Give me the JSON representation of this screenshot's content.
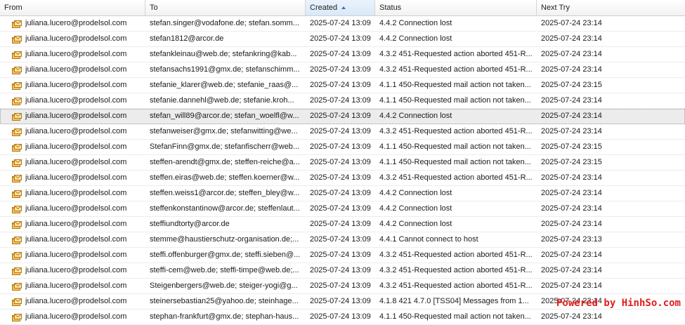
{
  "columns": {
    "from": "From",
    "to": "To",
    "created": "Created",
    "status": "Status",
    "next_try": "Next Try"
  },
  "sort": {
    "column": "created",
    "direction": "ascending"
  },
  "selected_row": 6,
  "icons": {
    "row_icon": "mail-envelope-icon",
    "accent": "#f0a830"
  },
  "rows": [
    {
      "from": "juliana.lucero@prodelsol.com",
      "to": "stefan.singer@vodafone.de; stefan.somm...",
      "created": "2025-07-24 13:09",
      "status": "4.4.2 Connection lost",
      "next_try": "2025-07-24 23:14"
    },
    {
      "from": "juliana.lucero@prodelsol.com",
      "to": "stefan1812@arcor.de",
      "created": "2025-07-24 13:09",
      "status": "4.4.2 Connection lost",
      "next_try": "2025-07-24 23:14"
    },
    {
      "from": "juliana.lucero@prodelsol.com",
      "to": "stefankleinau@web.de; stefankring@kab...",
      "created": "2025-07-24 13:09",
      "status": "4.3.2 451-Requested action aborted 451-R...",
      "next_try": "2025-07-24 23:14"
    },
    {
      "from": "juliana.lucero@prodelsol.com",
      "to": "stefansachs1991@gmx.de; stefanschimm...",
      "created": "2025-07-24 13:09",
      "status": "4.3.2 451-Requested action aborted 451-R...",
      "next_try": "2025-07-24 23:14"
    },
    {
      "from": "juliana.lucero@prodelsol.com",
      "to": "stefanie_klarer@web.de; stefanie_raas@...",
      "created": "2025-07-24 13:09",
      "status": "4.1.1 450-Requested mail action not taken...",
      "next_try": "2025-07-24 23:15"
    },
    {
      "from": "juliana.lucero@prodelsol.com",
      "to": "stefanie.dannehl@web.de; stefanie.kroh...",
      "created": "2025-07-24 13:09",
      "status": "4.1.1 450-Requested mail action not taken...",
      "next_try": "2025-07-24 23:14"
    },
    {
      "from": "juliana.lucero@prodelsol.com",
      "to": "stefan_will89@arcor.de; stefan_woelfl@w...",
      "created": "2025-07-24 13:09",
      "status": "4.4.2 Connection lost",
      "next_try": "2025-07-24 23:14"
    },
    {
      "from": "juliana.lucero@prodelsol.com",
      "to": "stefanweiser@gmx.de; stefanwitting@we...",
      "created": "2025-07-24 13:09",
      "status": "4.3.2 451-Requested action aborted 451-R...",
      "next_try": "2025-07-24 23:14"
    },
    {
      "from": "juliana.lucero@prodelsol.com",
      "to": "StefanFinn@gmx.de; stefanfischerr@web...",
      "created": "2025-07-24 13:09",
      "status": "4.1.1 450-Requested mail action not taken...",
      "next_try": "2025-07-24 23:15"
    },
    {
      "from": "juliana.lucero@prodelsol.com",
      "to": "steffen-arendt@gmx.de; steffen-reiche@a...",
      "created": "2025-07-24 13:09",
      "status": "4.1.1 450-Requested mail action not taken...",
      "next_try": "2025-07-24 23:15"
    },
    {
      "from": "juliana.lucero@prodelsol.com",
      "to": "steffen.eiras@web.de; steffen.koerner@w...",
      "created": "2025-07-24 13:09",
      "status": "4.3.2 451-Requested action aborted 451-R...",
      "next_try": "2025-07-24 23:14"
    },
    {
      "from": "juliana.lucero@prodelsol.com",
      "to": "steffen.weiss1@arcor.de; steffen_bley@w...",
      "created": "2025-07-24 13:09",
      "status": "4.4.2 Connection lost",
      "next_try": "2025-07-24 23:14"
    },
    {
      "from": "juliana.lucero@prodelsol.com",
      "to": "steffenkonstantinow@arcor.de; steffenlaut...",
      "created": "2025-07-24 13:09",
      "status": "4.4.2 Connection lost",
      "next_try": "2025-07-24 23:14"
    },
    {
      "from": "juliana.lucero@prodelsol.com",
      "to": "steffiundtorty@arcor.de",
      "created": "2025-07-24 13:09",
      "status": "4.4.2 Connection lost",
      "next_try": "2025-07-24 23:14"
    },
    {
      "from": "juliana.lucero@prodelsol.com",
      "to": "stemme@haustierschutz-organisation.de;...",
      "created": "2025-07-24 13:09",
      "status": "4.4.1 Cannot connect to host",
      "next_try": "2025-07-24 23:13"
    },
    {
      "from": "juliana.lucero@prodelsol.com",
      "to": "steffi.offenburger@gmx.de; steffi.sieben@...",
      "created": "2025-07-24 13:09",
      "status": "4.3.2 451-Requested action aborted 451-R...",
      "next_try": "2025-07-24 23:14"
    },
    {
      "from": "juliana.lucero@prodelsol.com",
      "to": "steffi-cem@web.de; steffi-timpe@web.de;...",
      "created": "2025-07-24 13:09",
      "status": "4.3.2 451-Requested action aborted 451-R...",
      "next_try": "2025-07-24 23:14"
    },
    {
      "from": "juliana.lucero@prodelsol.com",
      "to": "Steigenbergers@web.de; steiger-yogi@g...",
      "created": "2025-07-24 13:09",
      "status": "4.3.2 451-Requested action aborted 451-R...",
      "next_try": "2025-07-24 23:14"
    },
    {
      "from": "juliana.lucero@prodelsol.com",
      "to": "steinersebastian25@yahoo.de; steinhage...",
      "created": "2025-07-24 13:09",
      "status": "4.1.8 421 4.7.0 [TSS04] Messages from 1...",
      "next_try": "2025-07-24 23:14"
    },
    {
      "from": "juliana.lucero@prodelsol.com",
      "to": "stephan-frankfurt@gmx.de; stephan-haus...",
      "created": "2025-07-24 13:09",
      "status": "4.1.1 450-Requested mail action not taken...",
      "next_try": "2025-07-24 23:14"
    }
  ],
  "watermark": "Powered by HinhSo.com"
}
